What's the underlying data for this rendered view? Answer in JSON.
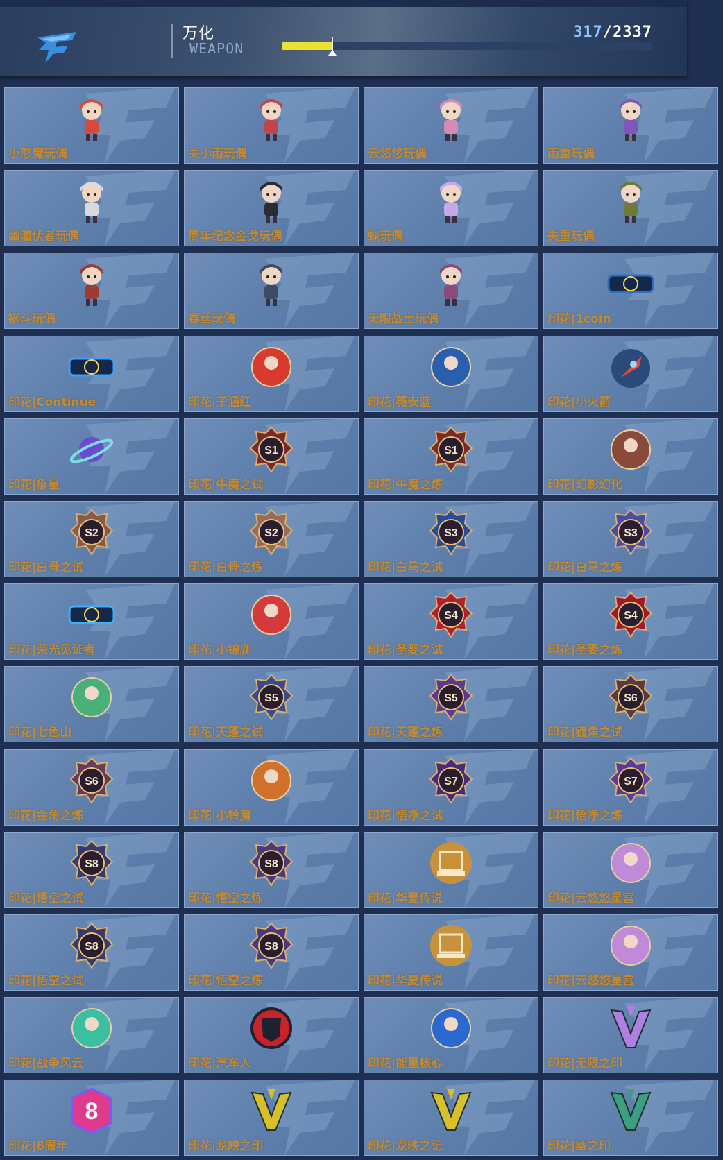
{
  "header": {
    "title": "万化",
    "subtitle": "WEAPON",
    "count_current": "317",
    "count_total": "/2337",
    "progress_fraction": 0.136,
    "accent_color": "#ece12e"
  },
  "items": [
    {
      "label": "小怒魔玩偶",
      "icon": "chibi-doll-icon",
      "color": "#d64a3a"
    },
    {
      "label": "关小雨玩偶",
      "icon": "chibi-doll-icon",
      "color": "#c0444c"
    },
    {
      "label": "云悠悠玩偶",
      "icon": "chibi-doll-icon",
      "color": "#d78ab8"
    },
    {
      "label": "雨重玩偶",
      "icon": "chibi-doll-icon",
      "color": "#7d58b8"
    },
    {
      "label": "幽潜伏者玩偶",
      "icon": "chibi-doll-icon",
      "color": "#d9d9e0"
    },
    {
      "label": "周年纪念金戈玩偶",
      "icon": "chibi-doll-icon",
      "color": "#2b2b33"
    },
    {
      "label": "蝶玩偶",
      "icon": "chibi-doll-icon",
      "color": "#c7a8e8"
    },
    {
      "label": "失重玩偶",
      "icon": "chibi-doll-icon",
      "color": "#6f7a3a"
    },
    {
      "label": "祸斗玩偶",
      "icon": "chibi-doll-icon",
      "color": "#9a3b34"
    },
    {
      "label": "赛丝玩偶",
      "icon": "chibi-doll-icon",
      "color": "#3b4b62"
    },
    {
      "label": "无限战士玩偶",
      "icon": "mech-doll-icon",
      "color": "#8a4a7a"
    },
    {
      "label": "印花|1coin",
      "icon": "coin-logo-icon",
      "color": "#2f6fc2"
    },
    {
      "label": "印花|Continue",
      "icon": "continue-logo-icon",
      "color": "#3aa0ff"
    },
    {
      "label": "印花|子涵红",
      "icon": "heart-girl-icon",
      "color": "#d83a2e"
    },
    {
      "label": "印花|薇安蓝",
      "icon": "portrait-badge-icon",
      "color": "#2a5fb0"
    },
    {
      "label": "印花|小火箭",
      "icon": "rocket-badge-icon",
      "color": "#e04a3a"
    },
    {
      "label": "印花|象星",
      "icon": "planet-icon",
      "color": "#6a4ad0"
    },
    {
      "label": "印花|牛魔之试",
      "icon": "season-badge-icon",
      "color": "#7a2a2a",
      "badge": "S1"
    },
    {
      "label": "印花|牛魔之炼",
      "icon": "season-badge-icon",
      "color": "#7a2a2a",
      "badge": "S1"
    },
    {
      "label": "印花|幻影幻化",
      "icon": "hooded-badge-icon",
      "color": "#8a4a3a"
    },
    {
      "label": "印花|白骨之试",
      "icon": "season-badge-icon",
      "color": "#8a5a4a",
      "badge": "S2"
    },
    {
      "label": "印花|白骨之炼",
      "icon": "season-badge-icon",
      "color": "#9a6a5a",
      "badge": "S2"
    },
    {
      "label": "印花|白马之试",
      "icon": "season-badge-icon",
      "color": "#2a4a9a",
      "badge": "S3"
    },
    {
      "label": "印花|白马之炼",
      "icon": "season-badge-icon",
      "color": "#4a4aa8",
      "badge": "S3"
    },
    {
      "label": "印花|荣光见证者",
      "icon": "cfml-logo-icon",
      "color": "#3ab0ff"
    },
    {
      "label": "印花|小锦鹿",
      "icon": "dragon-mask-icon",
      "color": "#d43a3a"
    },
    {
      "label": "印花|圣婴之试",
      "icon": "season-badge-icon",
      "color": "#b02030",
      "badge": "S4"
    },
    {
      "label": "印花|圣婴之炼",
      "icon": "season-badge-icon",
      "color": "#a01a2a",
      "badge": "S4"
    },
    {
      "label": "印花|七色山",
      "icon": "mountain-badge-icon",
      "color": "#4ab07a"
    },
    {
      "label": "印花|天蓬之试",
      "icon": "season-badge-icon",
      "color": "#3a4a8a",
      "badge": "S5"
    },
    {
      "label": "印花|天蓬之炼",
      "icon": "season-badge-icon",
      "color": "#5a3a8a",
      "badge": "S5"
    },
    {
      "label": "印花|镀角之试",
      "icon": "season-badge-icon",
      "color": "#5a3a3a",
      "badge": "S6"
    },
    {
      "label": "印花|金角之炼",
      "icon": "season-badge-icon",
      "color": "#6a3a5a",
      "badge": "S6"
    },
    {
      "label": "印花|小铃魔",
      "icon": "fox-badge-icon",
      "color": "#d0702a"
    },
    {
      "label": "印花|悟净之试",
      "icon": "season-badge-icon",
      "color": "#4a2a7a",
      "badge": "S7"
    },
    {
      "label": "印花|悟净之炼",
      "icon": "season-badge-icon",
      "color": "#5a3a9a",
      "badge": "S7"
    },
    {
      "label": "印花|悟空之试",
      "icon": "season-badge-icon",
      "color": "#3a3a6a",
      "badge": "S8"
    },
    {
      "label": "印花|悟空之炼",
      "icon": "season-badge-icon",
      "color": "#4a3a7a",
      "badge": "S8"
    },
    {
      "label": "印花|华夏传说",
      "icon": "gate-badge-icon",
      "color": "#c9923a"
    },
    {
      "label": "印花|云悠悠星宫",
      "icon": "portrait-badge-icon",
      "color": "#c08ad8"
    },
    {
      "label": "印花|悟空之试",
      "icon": "season-badge-icon",
      "color": "#3a3a6a",
      "badge": "S8"
    },
    {
      "label": "印花|悟空之炼",
      "icon": "season-badge-icon",
      "color": "#4a3a7a",
      "badge": "S8"
    },
    {
      "label": "印花|华夏传说",
      "icon": "gate-badge-icon",
      "color": "#c9923a"
    },
    {
      "label": "印花|云悠悠星宫",
      "icon": "portrait-badge-icon",
      "color": "#c08ad8"
    },
    {
      "label": "印花|战争风云",
      "icon": "aircraft-icon",
      "color": "#3ac0a0"
    },
    {
      "label": "印花|汽车人",
      "icon": "autobot-icon",
      "color": "#c8222a"
    },
    {
      "label": "印花|能量核心",
      "icon": "robot-core-icon",
      "color": "#2a6ad0"
    },
    {
      "label": "印花|无限之印",
      "icon": "v-emblem-icon",
      "color": "#b080e0"
    },
    {
      "label": "印花|8周年",
      "icon": "eight-badge-icon",
      "color": "#e03a8a"
    },
    {
      "label": "印花|龙映之印",
      "icon": "trident-emblem-icon",
      "color": "#d8c02a"
    },
    {
      "label": "印花|龙映之记",
      "icon": "trident-emblem-icon",
      "color": "#d8c02a"
    },
    {
      "label": "印花|幽之印",
      "icon": "trident-emblem-icon",
      "color": "#3aa080"
    }
  ]
}
